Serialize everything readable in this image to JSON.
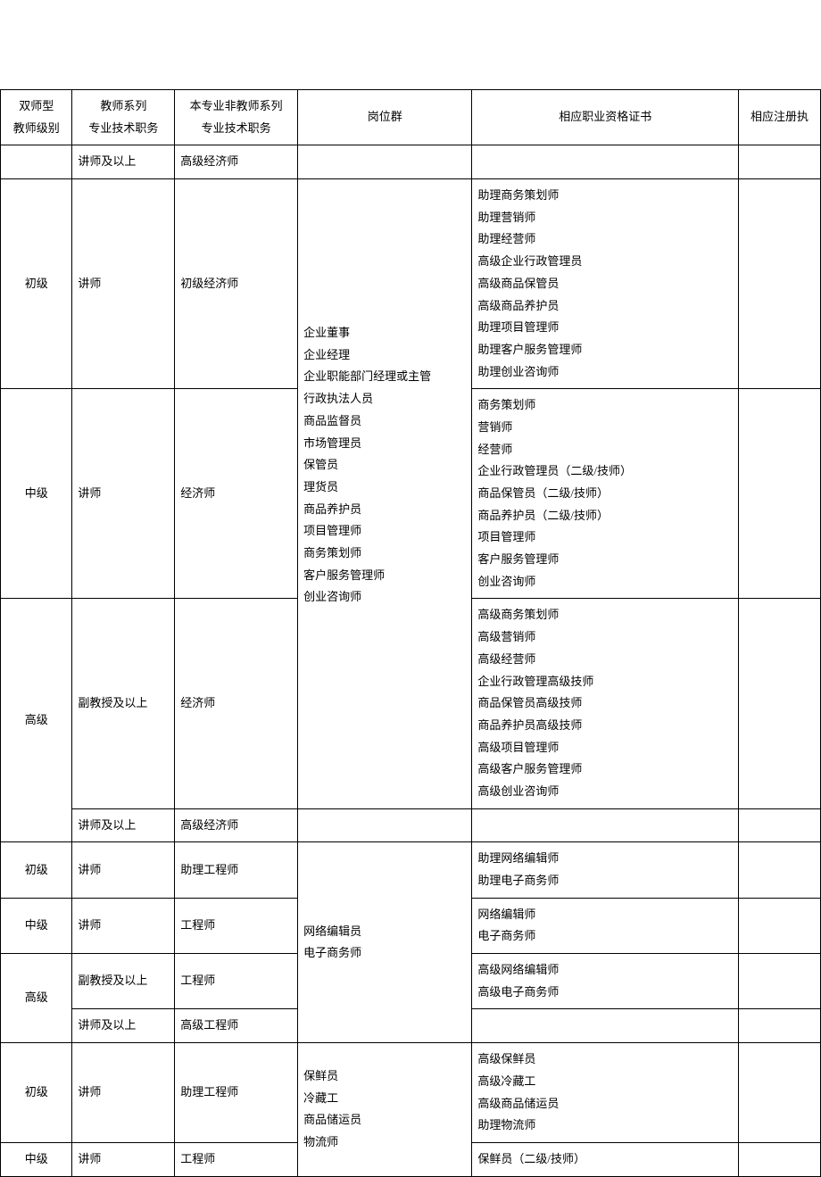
{
  "headers": {
    "col0_l1": "双师型",
    "col0_l2": "教师级别",
    "col1_l1": "教师系列",
    "col1_l2": "专业技术职务",
    "col2_l1": "本专业非教师系列",
    "col2_l2": "专业技术职务",
    "col3": "岗位群",
    "col4": "相应职业资格证书",
    "col5": "相应注册执"
  },
  "groupA": {
    "row0": {
      "c1": "讲师及以上",
      "c2": "高级经济师"
    },
    "positions": "企业董事\n企业经理\n企业职能部门经理或主管\n行政执法人员\n商品监督员\n市场管理员\n保管员\n理货员\n商品养护员\n项目管理师\n商务策划师\n客户服务管理师\n创业咨询师",
    "junior": {
      "level": "初级",
      "c1": "讲师",
      "c2": "初级经济师",
      "certs": "助理商务策划师\n助理营销师\n助理经营师\n高级企业行政管理员\n高级商品保管员\n高级商品养护员\n助理项目管理师\n助理客户服务管理师\n助理创业咨询师"
    },
    "mid": {
      "level": "中级",
      "c1": "讲师",
      "c2": "经济师",
      "certs": "商务策划师\n营销师\n经营师\n企业行政管理员（二级/技师）\n商品保管员（二级/技师）\n商品养护员（二级/技师）\n项目管理师\n客户服务管理师\n创业咨询师"
    },
    "senior": {
      "level": "高级",
      "r1c1": "副教授及以上",
      "r1c2": "经济师",
      "certs": "高级商务策划师\n高级营销师\n高级经营师\n企业行政管理高级技师\n商品保管员高级技师\n商品养护员高级技师\n高级项目管理师\n高级客户服务管理师\n高级创业咨询师",
      "r2c1": "讲师及以上",
      "r2c2": "高级经济师"
    }
  },
  "groupB": {
    "positions": "网络编辑员\n电子商务师",
    "junior": {
      "level": "初级",
      "c1": "讲师",
      "c2": "助理工程师",
      "certs": "助理网络编辑师\n助理电子商务师"
    },
    "mid": {
      "level": "中级",
      "c1": "讲师",
      "c2": "工程师",
      "certs": "网络编辑师\n电子商务师"
    },
    "senior": {
      "level": "高级",
      "r1c1": "副教授及以上",
      "r1c2": "工程师",
      "certs": "高级网络编辑师\n高级电子商务师",
      "r2c1": "讲师及以上",
      "r2c2": "高级工程师"
    }
  },
  "groupC": {
    "positions": "保鲜员\n冷藏工\n商品储运员\n物流师",
    "junior": {
      "level": "初级",
      "c1": "讲师",
      "c2": "助理工程师",
      "certs": "高级保鲜员\n高级冷藏工\n高级商品储运员\n助理物流师"
    },
    "mid": {
      "level": "中级",
      "c1": "讲师",
      "c2": "工程师",
      "certs": "保鲜员（二级/技师）"
    }
  }
}
